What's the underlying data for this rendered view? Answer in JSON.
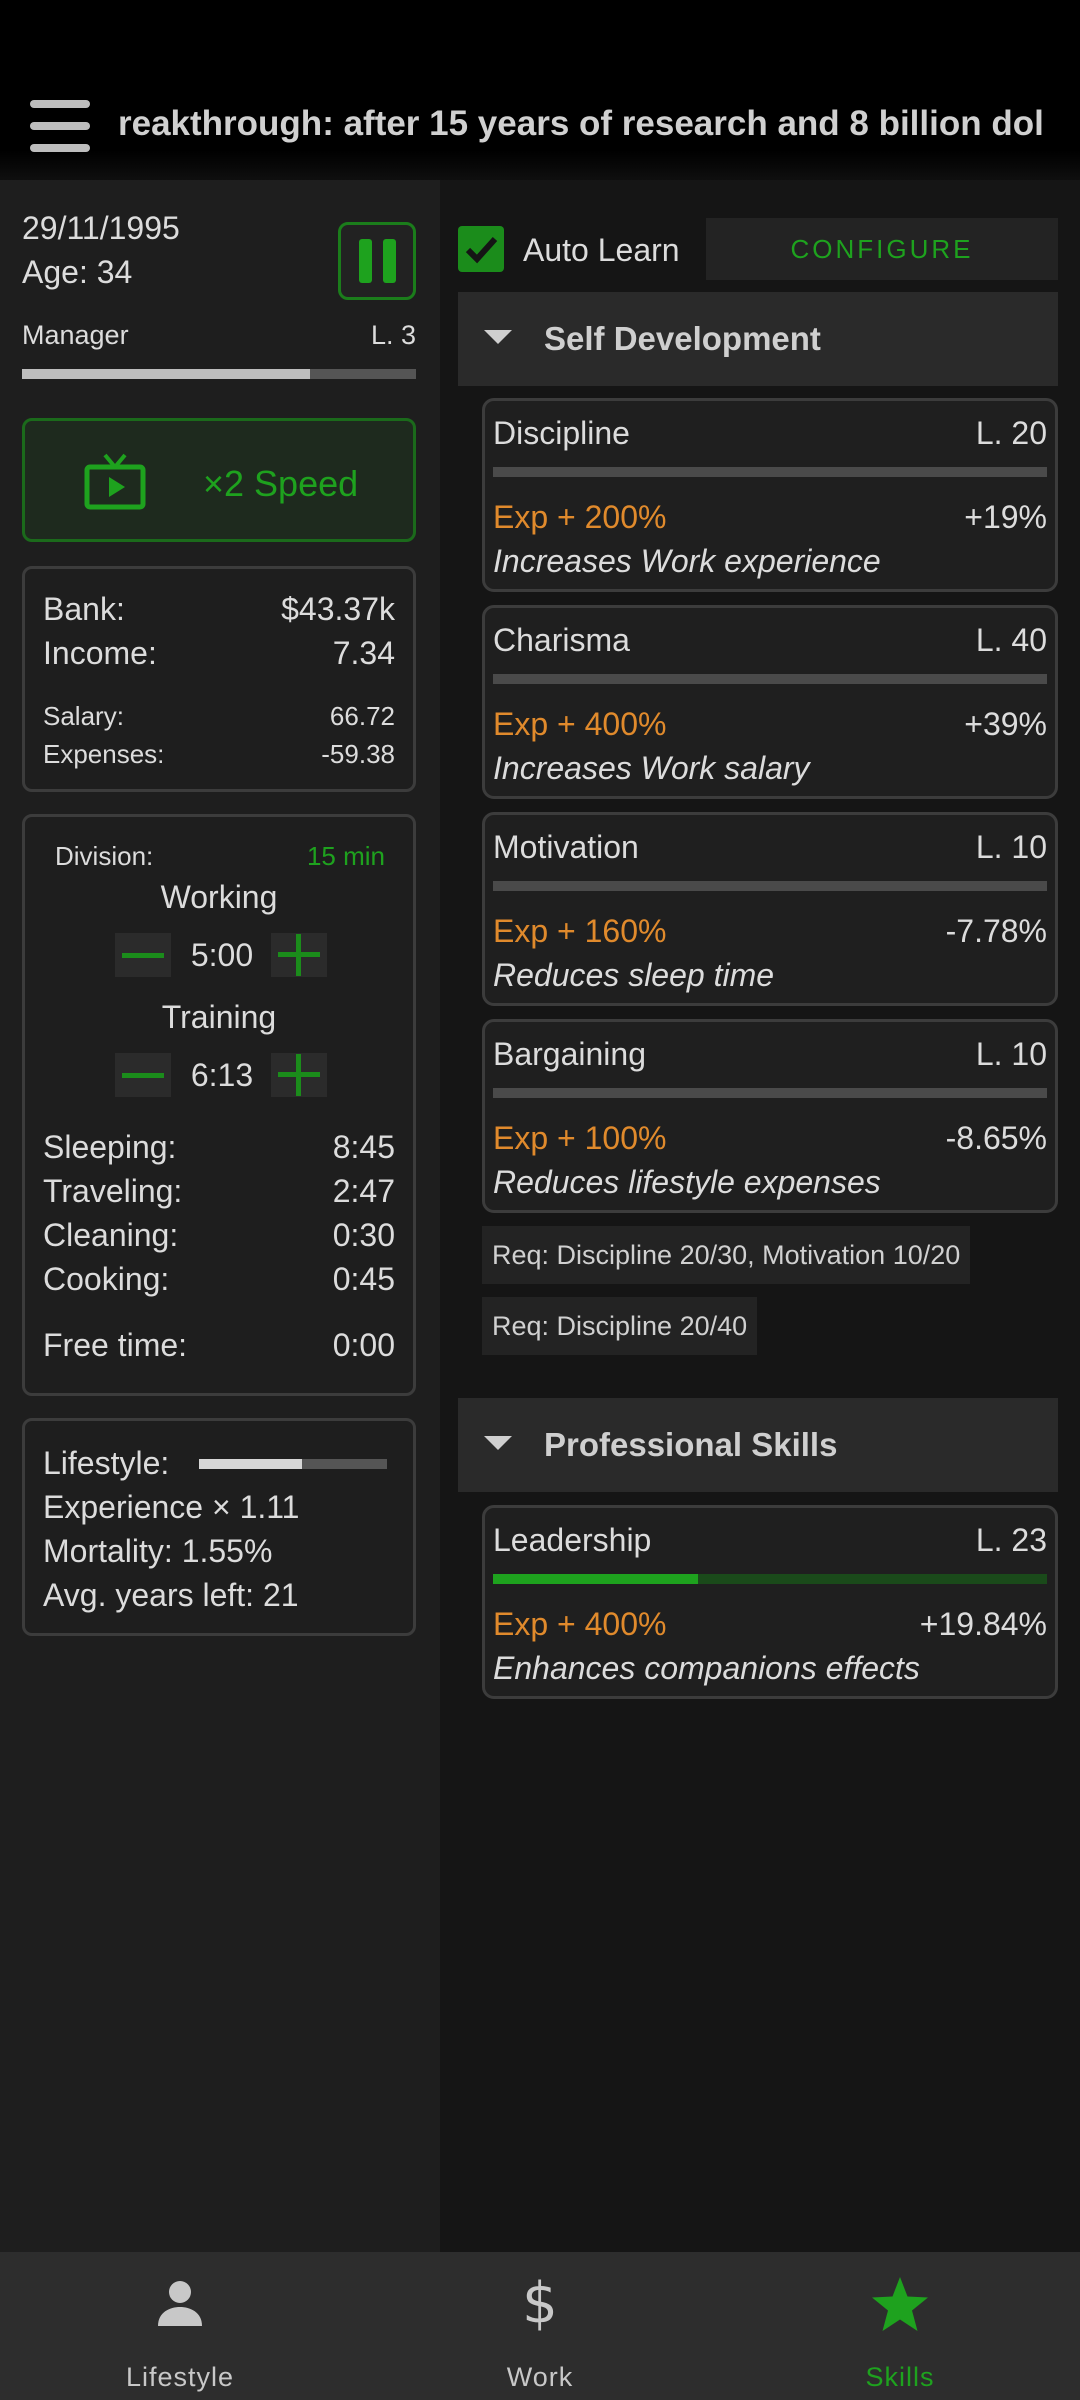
{
  "header": {
    "ticker": "reakthrough: after 15 years of research and 8 billion dol"
  },
  "status": {
    "date": "29/11/1995",
    "age": "Age: 34",
    "job_title": "Manager",
    "job_level": "L. 3",
    "job_progress": 0.73
  },
  "speed": {
    "label": "×2 Speed"
  },
  "finance": {
    "bank_label": "Bank:",
    "bank_value": "$43.37k",
    "income_label": "Income:",
    "income_value": "7.34",
    "salary_label": "Salary:",
    "salary_value": "66.72",
    "expenses_label": "Expenses:",
    "expenses_value": "-59.38"
  },
  "division": {
    "label": "Division:",
    "step": "15 min",
    "working_label": "Working",
    "working_value": "5:00",
    "training_label": "Training",
    "training_value": "6:13",
    "sleeping_label": "Sleeping:",
    "sleeping_value": "8:45",
    "traveling_label": "Traveling:",
    "traveling_value": "2:47",
    "cleaning_label": "Cleaning:",
    "cleaning_value": "0:30",
    "cooking_label": "Cooking:",
    "cooking_value": "0:45",
    "free_label": "Free time:",
    "free_value": "0:00"
  },
  "lifestyle": {
    "label": "Lifestyle:",
    "level": 0.55,
    "experience": "Experience × 1.11",
    "mortality": "Mortality: 1.55%",
    "years_left": "Avg. years left: 21"
  },
  "autolearn": {
    "label": "Auto Learn",
    "checked": true,
    "configure": "CONFIGURE"
  },
  "sections": {
    "self_dev": "Self Development",
    "professional": "Professional Skills"
  },
  "skills": [
    {
      "name": "Discipline",
      "level": "L. 20",
      "exp": "Exp + 200%",
      "effect": "+19%",
      "desc": "Increases Work experience",
      "progress": 0
    },
    {
      "name": "Charisma",
      "level": "L. 40",
      "exp": "Exp + 400%",
      "effect": "+39%",
      "desc": "Increases Work salary",
      "progress": 0
    },
    {
      "name": "Motivation",
      "level": "L. 10",
      "exp": "Exp + 160%",
      "effect": "-7.78%",
      "desc": "Reduces sleep time",
      "progress": 0
    },
    {
      "name": "Bargaining",
      "level": "L. 10",
      "exp": "Exp + 100%",
      "effect": "-8.65%",
      "desc": "Reduces lifestyle expenses",
      "progress": 0
    }
  ],
  "requirements": [
    "Req: Discipline 20/30, Motivation 10/20",
    "Req: Discipline 20/40"
  ],
  "professional_skills": [
    {
      "name": "Leadership",
      "level": "L. 23",
      "exp": "Exp + 400%",
      "effect": "+19.84%",
      "desc": "Enhances companions effects",
      "progress": 0.37
    }
  ],
  "nav": {
    "lifestyle": "Lifestyle",
    "work": "Work",
    "skills": "Skills",
    "active": "skills"
  },
  "colors": {
    "accent": "#1ea21e",
    "exp": "#e08a2c",
    "background": "#1c1c1c"
  }
}
